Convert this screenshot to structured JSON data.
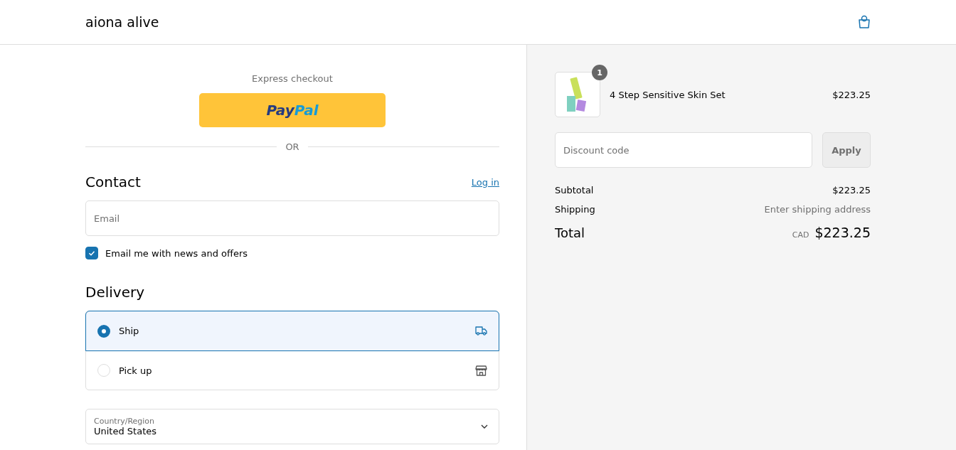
{
  "header": {
    "store_name": "aiona alive"
  },
  "express": {
    "title": "Express checkout",
    "paypal_logo": [
      "Pay",
      "Pal"
    ],
    "divider": "OR"
  },
  "contact": {
    "title": "Contact",
    "login_link": "Log in",
    "email": {
      "placeholder": "Email"
    },
    "newsletter": {
      "label": "Email me with news and offers",
      "checked": true
    }
  },
  "delivery": {
    "title": "Delivery",
    "options": [
      {
        "label": "Ship",
        "kind": "truck",
        "selected": true
      },
      {
        "label": "Pick up",
        "kind": "store",
        "selected": false
      }
    ],
    "country": {
      "label": "Country/Region",
      "value": "United States"
    }
  },
  "summary": {
    "item": {
      "name": "4 Step Sensitive Skin Set",
      "price": "$223.25",
      "quantity": "1"
    },
    "discount": {
      "placeholder": "Discount code",
      "button": "Apply"
    },
    "subtotal": {
      "label": "Subtotal",
      "value": "$223.25"
    },
    "shipping": {
      "label": "Shipping",
      "value": "Enter shipping address"
    },
    "total": {
      "label": "Total",
      "currency": "CAD",
      "value": "$223.25"
    }
  }
}
